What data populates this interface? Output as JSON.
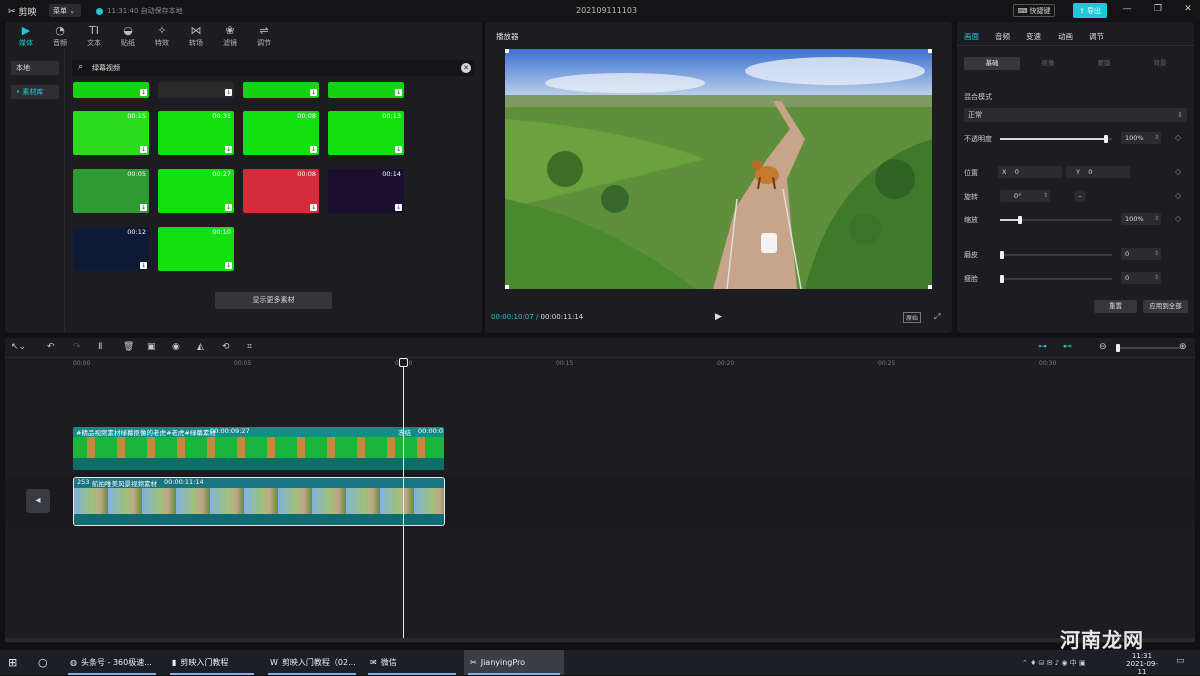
{
  "titlebar": {
    "app_name": "剪映",
    "menu_label": "菜单",
    "autosave": "11:31:40 自动保存本地",
    "project_name": "202109111103",
    "shortcut_label": "快捷键",
    "export_label": "导出"
  },
  "tools": [
    {
      "label": "媒体",
      "icon": "media-icon",
      "active": true
    },
    {
      "label": "音频",
      "icon": "audio-icon"
    },
    {
      "label": "文本",
      "icon": "text-icon"
    },
    {
      "label": "贴纸",
      "icon": "sticker-icon"
    },
    {
      "label": "特效",
      "icon": "effects-icon"
    },
    {
      "label": "转场",
      "icon": "transition-icon"
    },
    {
      "label": "滤镜",
      "icon": "filter-icon"
    },
    {
      "label": "调节",
      "icon": "adjust-icon"
    }
  ],
  "sidebar": {
    "items": [
      {
        "label": "本地"
      },
      {
        "label": "• 素材库",
        "active": true
      }
    ]
  },
  "search": {
    "value": "绿幕视频"
  },
  "thumbs": [
    {
      "duration": ""
    },
    {
      "duration": ""
    },
    {
      "duration": ""
    },
    {
      "duration": ""
    },
    {
      "duration": "00:15"
    },
    {
      "duration": "00:31"
    },
    {
      "duration": "00:08"
    },
    {
      "duration": "00:13"
    },
    {
      "duration": "00:05"
    },
    {
      "duration": "00:27"
    },
    {
      "duration": "00:08"
    },
    {
      "duration": "00:14"
    },
    {
      "duration": "00:12"
    },
    {
      "duration": "00:10"
    }
  ],
  "more_button": "显示更多素材",
  "player": {
    "title": "播放器",
    "current_time": "00:00:10:07",
    "total_time": "00:00:11:14",
    "ratio_label": "原始"
  },
  "props": {
    "tabs": [
      "画面",
      "音频",
      "变速",
      "动画",
      "调节"
    ],
    "subtabs": [
      "基础",
      "抠像",
      "蒙版",
      "背景"
    ],
    "blend_label": "混合模式",
    "blend_value": "正常",
    "opacity_label": "不透明度",
    "opacity_value": "100%",
    "opacity_level": 0.95,
    "position_label": "位置",
    "pos_x_label": "X",
    "pos_x": "0",
    "pos_y_label": "Y",
    "pos_y": "0",
    "rotate_label": "旋转",
    "rotate_value": "0°",
    "scale_label": "缩放",
    "scale_value": "100%",
    "scale_level": 0.18,
    "brightness_label": "磨皮",
    "brightness_value": "0",
    "thin_label": "瘦脸",
    "thin_value": "0",
    "reset_label": "重置",
    "apply_all_label": "应用到全部"
  },
  "timeline": {
    "ruler": [
      "00:00",
      "00:05",
      "00:10",
      "00:15",
      "00:20",
      "00:25",
      "00:30"
    ],
    "clip_a": {
      "name": "#精品视频素材绿幕抠像的老虎#老虎#绿幕素材",
      "duration": "00:00:09:27",
      "tail_label": "冻结",
      "tail_time": "00:00:01"
    },
    "clip_b": {
      "badge": "253",
      "name": "航拍唯美风景视频素材",
      "duration": "00:00:11:14"
    }
  },
  "taskbar": {
    "items": [
      {
        "label": "头条号 - 360极速..."
      },
      {
        "label": "剪映入门教程"
      },
      {
        "label": "剪映入门教程（02..."
      },
      {
        "label": "微信"
      },
      {
        "label": "JianyingPro",
        "active": true
      }
    ],
    "time": "11:31",
    "date": "2021-09-11"
  },
  "watermark": "河南龙网"
}
